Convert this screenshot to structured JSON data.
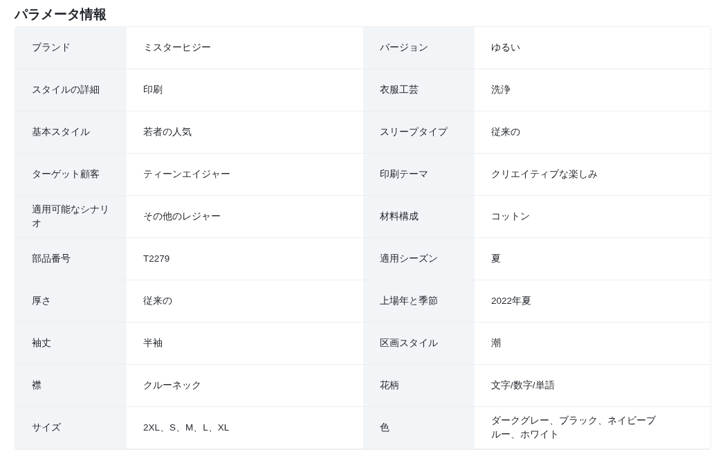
{
  "title": "パラメータ情報",
  "rows": [
    [
      {
        "label": "ブランド",
        "value": "ミスターヒジー"
      },
      {
        "label": "バージョン",
        "value": "ゆるい"
      }
    ],
    [
      {
        "label": "スタイルの詳細",
        "value": "印刷"
      },
      {
        "label": "衣服工芸",
        "value": "洗浄"
      }
    ],
    [
      {
        "label": "基本スタイル",
        "value": "若者の人気"
      },
      {
        "label": "スリープタイプ",
        "value": "従来の"
      }
    ],
    [
      {
        "label": "ターゲット顧客",
        "value": "ティーンエイジャー"
      },
      {
        "label": "印刷テーマ",
        "value": "クリエイティブな楽しみ"
      }
    ],
    [
      {
        "label": "適用可能なシナリオ",
        "value": "その他のレジャー"
      },
      {
        "label": "材料構成",
        "value": "コットン"
      }
    ],
    [
      {
        "label": "部品番号",
        "value": "T2279"
      },
      {
        "label": "適用シーズン",
        "value": "夏"
      }
    ],
    [
      {
        "label": "厚さ",
        "value": "従来の"
      },
      {
        "label": "上場年と季節",
        "value": "2022年夏"
      }
    ],
    [
      {
        "label": "袖丈",
        "value": "半袖"
      },
      {
        "label": "区画スタイル",
        "value": "潮"
      }
    ],
    [
      {
        "label": "襟",
        "value": "クルーネック"
      },
      {
        "label": "花柄",
        "value": "文字/数字/単語"
      }
    ],
    [
      {
        "label": "サイズ",
        "value": "2XL、S、M、L、XL"
      },
      {
        "label": "色",
        "value": "ダークグレー、ブラック、ネイビーブルー、ホワイト"
      }
    ]
  ]
}
